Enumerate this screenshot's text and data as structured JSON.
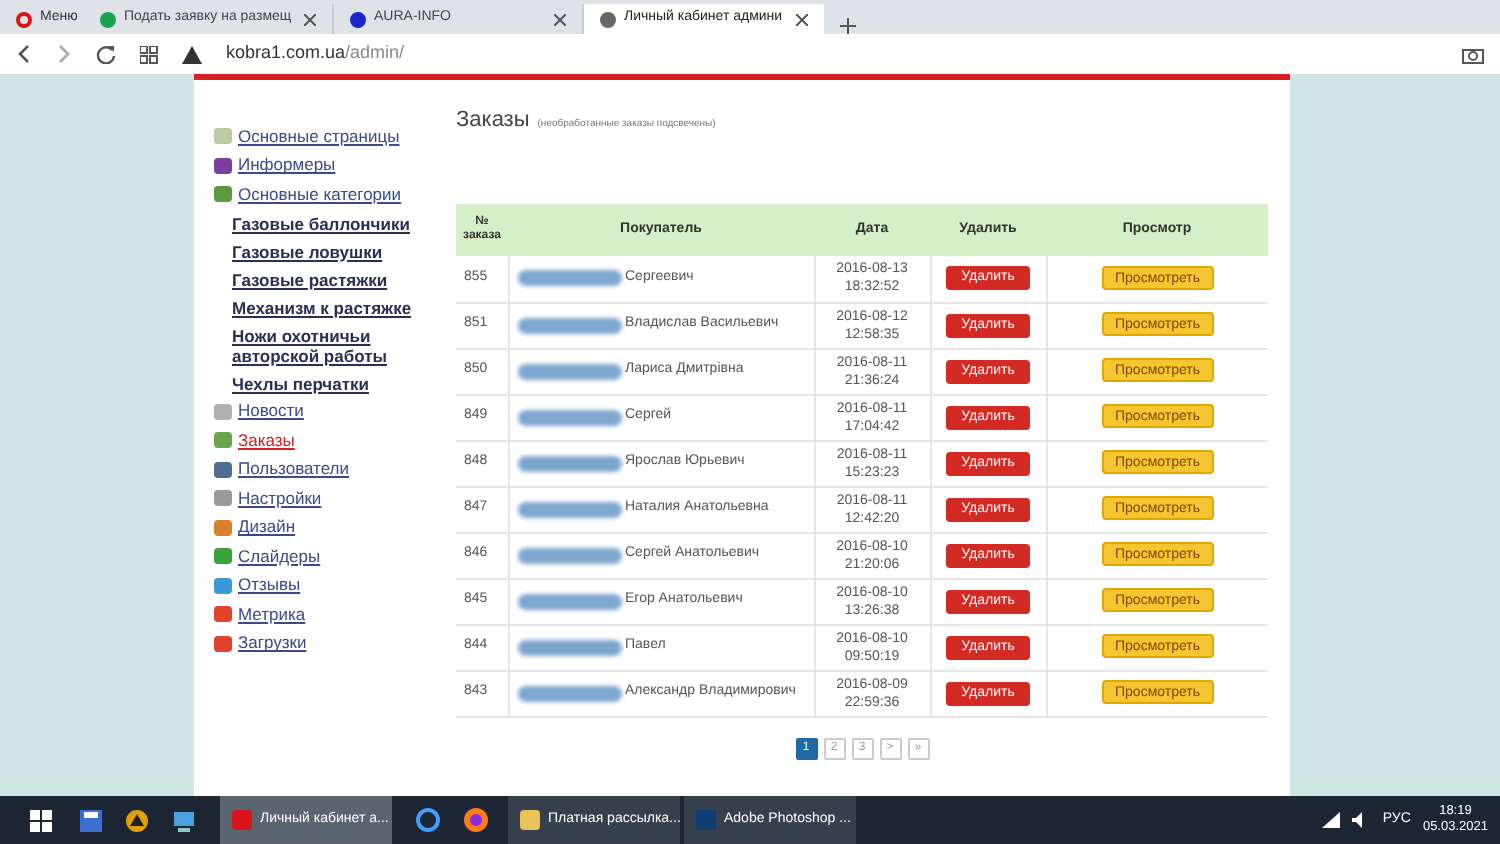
{
  "browser": {
    "tabs": [
      {
        "kind": "menu",
        "label": "Меню",
        "selected": false,
        "color": "#d8151b"
      },
      {
        "kind": "tab",
        "label": "Подать заявку на размещ",
        "selected": false,
        "color": "#1aa34a"
      },
      {
        "kind": "tab",
        "label": "AURA-INFO",
        "selected": false,
        "color": "#1a27c9"
      },
      {
        "kind": "tab",
        "label": "Личный кабинет админи",
        "selected": true,
        "color": "#666666"
      }
    ],
    "address_host": "kobra1.com.ua",
    "address_path": "/admin/"
  },
  "sidebar": {
    "items": [
      {
        "label": "Основные страницы",
        "selected": false,
        "color": "#b9c9a0"
      },
      {
        "label": "Информеры",
        "selected": false,
        "color": "#7b3fa0"
      },
      {
        "label": "Основные категории",
        "selected": false,
        "color": "#5b9a3c",
        "children": [
          {
            "label": "Газовые баллончики"
          },
          {
            "label": "Газовые ловушки"
          },
          {
            "label": "Газовые растяжки"
          },
          {
            "label": "Механизм к растяжке"
          },
          {
            "label": "Ножи охотничьи авторской работы"
          },
          {
            "label": "Чехлы перчатки"
          }
        ]
      },
      {
        "label": "Новости",
        "selected": false,
        "color": "#b0b0b0"
      },
      {
        "label": "Заказы",
        "selected": true,
        "color": "#6aa84f"
      },
      {
        "label": "Пользователи",
        "selected": false,
        "color": "#4f6d8f"
      },
      {
        "label": "Настройки",
        "selected": false,
        "color": "#9a9a9a"
      },
      {
        "label": "Дизайн",
        "selected": false,
        "color": "#d9822b"
      },
      {
        "label": "Слайдеры",
        "selected": false,
        "color": "#3aa33a"
      },
      {
        "label": "Отзывы",
        "selected": false,
        "color": "#3a9ad9"
      },
      {
        "label": "Метрика",
        "selected": false,
        "color": "#e0442b"
      },
      {
        "label": "Загрузки",
        "selected": false,
        "color": "#e0442b"
      }
    ]
  },
  "orders": {
    "title": "Заказы",
    "subtitle": "(необработанные заказы подсвечены)",
    "columns": [
      "№ заказа",
      "Покупатель",
      "Дата",
      "Удалить",
      "Просмотр"
    ],
    "rows": [
      {
        "number": "855",
        "customer": "Сергеевич",
        "date": "2016-08-13",
        "time": "18:32:52",
        "delete": "Удалить",
        "view": "Просмотреть"
      },
      {
        "number": "851",
        "customer": "Владислав Васильевич",
        "date": "2016-08-12",
        "time": "12:58:35",
        "delete": "Удалить",
        "view": "Просмотреть"
      },
      {
        "number": "850",
        "customer": "Лариса Дмитрівна",
        "date": "2016-08-11",
        "time": "21:36:24",
        "delete": "Удалить",
        "view": "Просмотреть"
      },
      {
        "number": "849",
        "customer": "Сергей",
        "date": "2016-08-11",
        "time": "17:04:42",
        "delete": "Удалить",
        "view": "Просмотреть"
      },
      {
        "number": "848",
        "customer": "Ярослав Юрьевич",
        "date": "2016-08-11",
        "time": "15:23:23",
        "delete": "Удалить",
        "view": "Просмотреть"
      },
      {
        "number": "847",
        "customer": "Наталия Анатольевна",
        "date": "2016-08-11",
        "time": "12:42:20",
        "delete": "Удалить",
        "view": "Просмотреть"
      },
      {
        "number": "846",
        "customer": "Сергей Анатольевич",
        "date": "2016-08-10",
        "time": "21:20:06",
        "delete": "Удалить",
        "view": "Просмотреть"
      },
      {
        "number": "845",
        "customer": "Егор Анатольевич",
        "date": "2016-08-10",
        "time": "13:26:38",
        "delete": "Удалить",
        "view": "Просмотреть"
      },
      {
        "number": "844",
        "customer": "Павел",
        "date": "2016-08-10",
        "time": "09:50:19",
        "delete": "Удалить",
        "view": "Просмотреть"
      },
      {
        "number": "843",
        "customer": "Александр Владимирович",
        "date": "2016-08-09",
        "time": "22:59:36",
        "delete": "Удалить",
        "view": "Просмотреть"
      }
    ],
    "pagination": [
      {
        "label": "1",
        "selected": true
      },
      {
        "label": "2",
        "selected": false
      },
      {
        "label": "3",
        "selected": false
      },
      {
        "label": ">",
        "selected": false
      },
      {
        "label": "»",
        "selected": false
      }
    ]
  },
  "taskbar": {
    "items": [
      {
        "label": "Личный кабинет а...",
        "active": true,
        "color": "#d8151b"
      },
      {
        "label": "Платная рассылка...",
        "active": false,
        "color": "#e8c15a"
      },
      {
        "label": "Adobe Photoshop ...",
        "active": false,
        "color": "#0b3c72"
      }
    ],
    "language": "РУС",
    "time": "18:19",
    "date": "05.03.2021"
  }
}
